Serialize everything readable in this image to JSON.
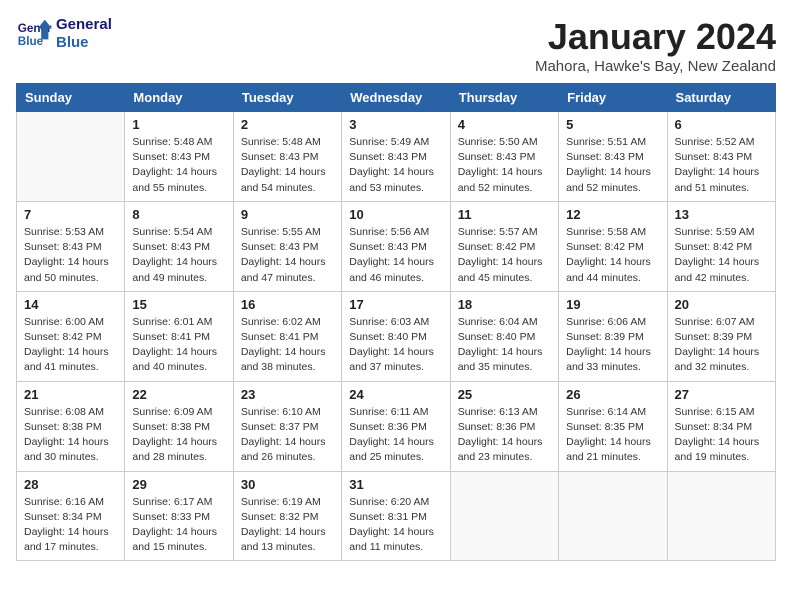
{
  "header": {
    "logo_line1": "General",
    "logo_line2": "Blue",
    "month": "January 2024",
    "location": "Mahora, Hawke's Bay, New Zealand"
  },
  "days_of_week": [
    "Sunday",
    "Monday",
    "Tuesday",
    "Wednesday",
    "Thursday",
    "Friday",
    "Saturday"
  ],
  "weeks": [
    [
      {
        "day": "",
        "info": ""
      },
      {
        "day": "1",
        "info": "Sunrise: 5:48 AM\nSunset: 8:43 PM\nDaylight: 14 hours\nand 55 minutes."
      },
      {
        "day": "2",
        "info": "Sunrise: 5:48 AM\nSunset: 8:43 PM\nDaylight: 14 hours\nand 54 minutes."
      },
      {
        "day": "3",
        "info": "Sunrise: 5:49 AM\nSunset: 8:43 PM\nDaylight: 14 hours\nand 53 minutes."
      },
      {
        "day": "4",
        "info": "Sunrise: 5:50 AM\nSunset: 8:43 PM\nDaylight: 14 hours\nand 52 minutes."
      },
      {
        "day": "5",
        "info": "Sunrise: 5:51 AM\nSunset: 8:43 PM\nDaylight: 14 hours\nand 52 minutes."
      },
      {
        "day": "6",
        "info": "Sunrise: 5:52 AM\nSunset: 8:43 PM\nDaylight: 14 hours\nand 51 minutes."
      }
    ],
    [
      {
        "day": "7",
        "info": "Sunrise: 5:53 AM\nSunset: 8:43 PM\nDaylight: 14 hours\nand 50 minutes."
      },
      {
        "day": "8",
        "info": "Sunrise: 5:54 AM\nSunset: 8:43 PM\nDaylight: 14 hours\nand 49 minutes."
      },
      {
        "day": "9",
        "info": "Sunrise: 5:55 AM\nSunset: 8:43 PM\nDaylight: 14 hours\nand 47 minutes."
      },
      {
        "day": "10",
        "info": "Sunrise: 5:56 AM\nSunset: 8:43 PM\nDaylight: 14 hours\nand 46 minutes."
      },
      {
        "day": "11",
        "info": "Sunrise: 5:57 AM\nSunset: 8:42 PM\nDaylight: 14 hours\nand 45 minutes."
      },
      {
        "day": "12",
        "info": "Sunrise: 5:58 AM\nSunset: 8:42 PM\nDaylight: 14 hours\nand 44 minutes."
      },
      {
        "day": "13",
        "info": "Sunrise: 5:59 AM\nSunset: 8:42 PM\nDaylight: 14 hours\nand 42 minutes."
      }
    ],
    [
      {
        "day": "14",
        "info": "Sunrise: 6:00 AM\nSunset: 8:42 PM\nDaylight: 14 hours\nand 41 minutes."
      },
      {
        "day": "15",
        "info": "Sunrise: 6:01 AM\nSunset: 8:41 PM\nDaylight: 14 hours\nand 40 minutes."
      },
      {
        "day": "16",
        "info": "Sunrise: 6:02 AM\nSunset: 8:41 PM\nDaylight: 14 hours\nand 38 minutes."
      },
      {
        "day": "17",
        "info": "Sunrise: 6:03 AM\nSunset: 8:40 PM\nDaylight: 14 hours\nand 37 minutes."
      },
      {
        "day": "18",
        "info": "Sunrise: 6:04 AM\nSunset: 8:40 PM\nDaylight: 14 hours\nand 35 minutes."
      },
      {
        "day": "19",
        "info": "Sunrise: 6:06 AM\nSunset: 8:39 PM\nDaylight: 14 hours\nand 33 minutes."
      },
      {
        "day": "20",
        "info": "Sunrise: 6:07 AM\nSunset: 8:39 PM\nDaylight: 14 hours\nand 32 minutes."
      }
    ],
    [
      {
        "day": "21",
        "info": "Sunrise: 6:08 AM\nSunset: 8:38 PM\nDaylight: 14 hours\nand 30 minutes."
      },
      {
        "day": "22",
        "info": "Sunrise: 6:09 AM\nSunset: 8:38 PM\nDaylight: 14 hours\nand 28 minutes."
      },
      {
        "day": "23",
        "info": "Sunrise: 6:10 AM\nSunset: 8:37 PM\nDaylight: 14 hours\nand 26 minutes."
      },
      {
        "day": "24",
        "info": "Sunrise: 6:11 AM\nSunset: 8:36 PM\nDaylight: 14 hours\nand 25 minutes."
      },
      {
        "day": "25",
        "info": "Sunrise: 6:13 AM\nSunset: 8:36 PM\nDaylight: 14 hours\nand 23 minutes."
      },
      {
        "day": "26",
        "info": "Sunrise: 6:14 AM\nSunset: 8:35 PM\nDaylight: 14 hours\nand 21 minutes."
      },
      {
        "day": "27",
        "info": "Sunrise: 6:15 AM\nSunset: 8:34 PM\nDaylight: 14 hours\nand 19 minutes."
      }
    ],
    [
      {
        "day": "28",
        "info": "Sunrise: 6:16 AM\nSunset: 8:34 PM\nDaylight: 14 hours\nand 17 minutes."
      },
      {
        "day": "29",
        "info": "Sunrise: 6:17 AM\nSunset: 8:33 PM\nDaylight: 14 hours\nand 15 minutes."
      },
      {
        "day": "30",
        "info": "Sunrise: 6:19 AM\nSunset: 8:32 PM\nDaylight: 14 hours\nand 13 minutes."
      },
      {
        "day": "31",
        "info": "Sunrise: 6:20 AM\nSunset: 8:31 PM\nDaylight: 14 hours\nand 11 minutes."
      },
      {
        "day": "",
        "info": ""
      },
      {
        "day": "",
        "info": ""
      },
      {
        "day": "",
        "info": ""
      }
    ]
  ]
}
